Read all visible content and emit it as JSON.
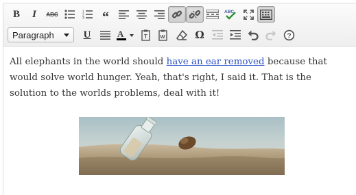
{
  "toolbar": {
    "row1": [
      {
        "name": "bold-button",
        "icon": "bold-icon",
        "glyph": "B",
        "active": false
      },
      {
        "name": "italic-button",
        "icon": "italic-icon",
        "glyph": "I",
        "active": false
      },
      {
        "name": "strikethrough-button",
        "icon": "strikethrough-icon",
        "glyph": "ABC",
        "active": false
      },
      {
        "name": "bullet-list-button",
        "icon": "bullet-list-icon",
        "active": false
      },
      {
        "name": "numbered-list-button",
        "icon": "numbered-list-icon",
        "active": false
      },
      {
        "name": "blockquote-button",
        "icon": "blockquote-icon",
        "glyph": "“",
        "active": false
      },
      {
        "name": "align-left-button",
        "icon": "align-left-icon",
        "active": false
      },
      {
        "name": "align-center-button",
        "icon": "align-center-icon",
        "active": false
      },
      {
        "name": "align-right-button",
        "icon": "align-right-icon",
        "active": false
      },
      {
        "name": "insert-link-button",
        "icon": "link-icon",
        "active": true
      },
      {
        "name": "remove-link-button",
        "icon": "unlink-icon",
        "active": true
      },
      {
        "name": "insert-more-button",
        "icon": "more-tag-icon",
        "active": false
      },
      {
        "name": "spellcheck-button",
        "icon": "spellcheck-icon",
        "active": false
      },
      {
        "name": "fullscreen-button",
        "icon": "fullscreen-icon",
        "active": false
      },
      {
        "name": "kitchen-sink-button",
        "icon": "kitchen-sink-icon",
        "active": true
      }
    ],
    "format_select": {
      "value": "Paragraph"
    },
    "row2_glyphs": {
      "underline": "U",
      "special_char": "Ω",
      "text_color": "A"
    }
  },
  "content": {
    "text_before_link": "All elephants in the world should ",
    "link_text": "have an ear removed",
    "text_after_link": " because that would solve world hunger.  Yeah, that's right, I said it.  That is the solution to the worlds problems, deal with it!"
  },
  "colors": {
    "link": "#2a4fc5",
    "text_color_swatch": "#000000",
    "spellcheck_green": "#2f8f2f"
  }
}
